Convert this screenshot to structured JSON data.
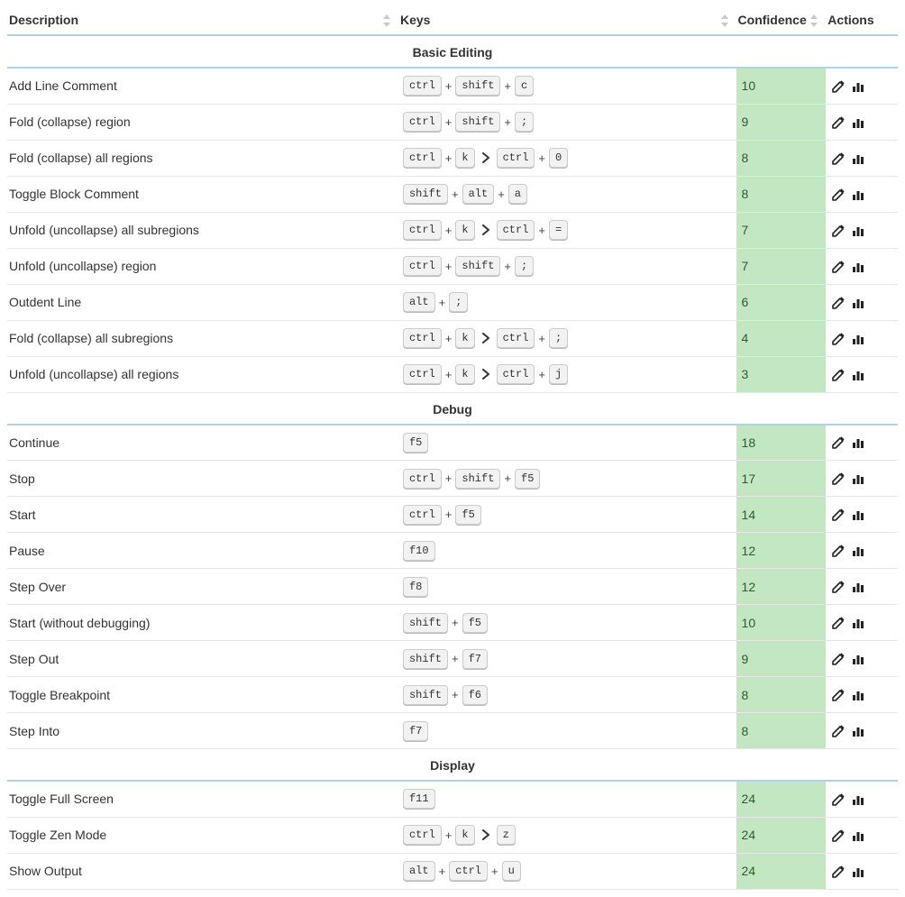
{
  "headers": {
    "description": "Description",
    "keys": "Keys",
    "confidence": "Confidence",
    "actions": "Actions"
  },
  "groups": [
    {
      "title": "Basic Editing",
      "rows": [
        {
          "description": "Add Line Comment",
          "keys": [
            [
              "ctrl",
              "shift",
              "c"
            ]
          ],
          "confidence": 10
        },
        {
          "description": "Fold (collapse) region",
          "keys": [
            [
              "ctrl",
              "shift",
              ";"
            ]
          ],
          "confidence": 9
        },
        {
          "description": "Fold (collapse) all regions",
          "keys": [
            [
              "ctrl",
              "k"
            ],
            [
              "ctrl",
              "0"
            ]
          ],
          "confidence": 8
        },
        {
          "description": "Toggle Block Comment",
          "keys": [
            [
              "shift",
              "alt",
              "a"
            ]
          ],
          "confidence": 8
        },
        {
          "description": "Unfold (uncollapse) all subregions",
          "keys": [
            [
              "ctrl",
              "k"
            ],
            [
              "ctrl",
              "="
            ]
          ],
          "confidence": 7
        },
        {
          "description": "Unfold (uncollapse) region",
          "keys": [
            [
              "ctrl",
              "shift",
              ";"
            ]
          ],
          "confidence": 7
        },
        {
          "description": "Outdent Line",
          "keys": [
            [
              "alt",
              ";"
            ]
          ],
          "confidence": 6
        },
        {
          "description": "Fold (collapse) all subregions",
          "keys": [
            [
              "ctrl",
              "k"
            ],
            [
              "ctrl",
              ";"
            ]
          ],
          "confidence": 4
        },
        {
          "description": "Unfold (uncollapse) all regions",
          "keys": [
            [
              "ctrl",
              "k"
            ],
            [
              "ctrl",
              "j"
            ]
          ],
          "confidence": 3
        }
      ]
    },
    {
      "title": "Debug",
      "rows": [
        {
          "description": "Continue",
          "keys": [
            [
              "f5"
            ]
          ],
          "confidence": 18
        },
        {
          "description": "Stop",
          "keys": [
            [
              "ctrl",
              "shift",
              "f5"
            ]
          ],
          "confidence": 17
        },
        {
          "description": "Start",
          "keys": [
            [
              "ctrl",
              "f5"
            ]
          ],
          "confidence": 14
        },
        {
          "description": "Pause",
          "keys": [
            [
              "f10"
            ]
          ],
          "confidence": 12
        },
        {
          "description": "Step Over",
          "keys": [
            [
              "f8"
            ]
          ],
          "confidence": 12
        },
        {
          "description": "Start (without debugging)",
          "keys": [
            [
              "shift",
              "f5"
            ]
          ],
          "confidence": 10
        },
        {
          "description": "Step Out",
          "keys": [
            [
              "shift",
              "f7"
            ]
          ],
          "confidence": 9
        },
        {
          "description": "Toggle Breakpoint",
          "keys": [
            [
              "shift",
              "f6"
            ]
          ],
          "confidence": 8
        },
        {
          "description": "Step Into",
          "keys": [
            [
              "f7"
            ]
          ],
          "confidence": 8
        }
      ]
    },
    {
      "title": "Display",
      "rows": [
        {
          "description": "Toggle Full Screen",
          "keys": [
            [
              "f11"
            ]
          ],
          "confidence": 24
        },
        {
          "description": "Toggle Zen Mode",
          "keys": [
            [
              "ctrl",
              "k"
            ],
            [
              "z"
            ]
          ],
          "confidence": 24
        },
        {
          "description": "Show Output",
          "keys": [
            [
              "alt",
              "ctrl",
              "u"
            ]
          ],
          "confidence": 24
        }
      ]
    }
  ]
}
